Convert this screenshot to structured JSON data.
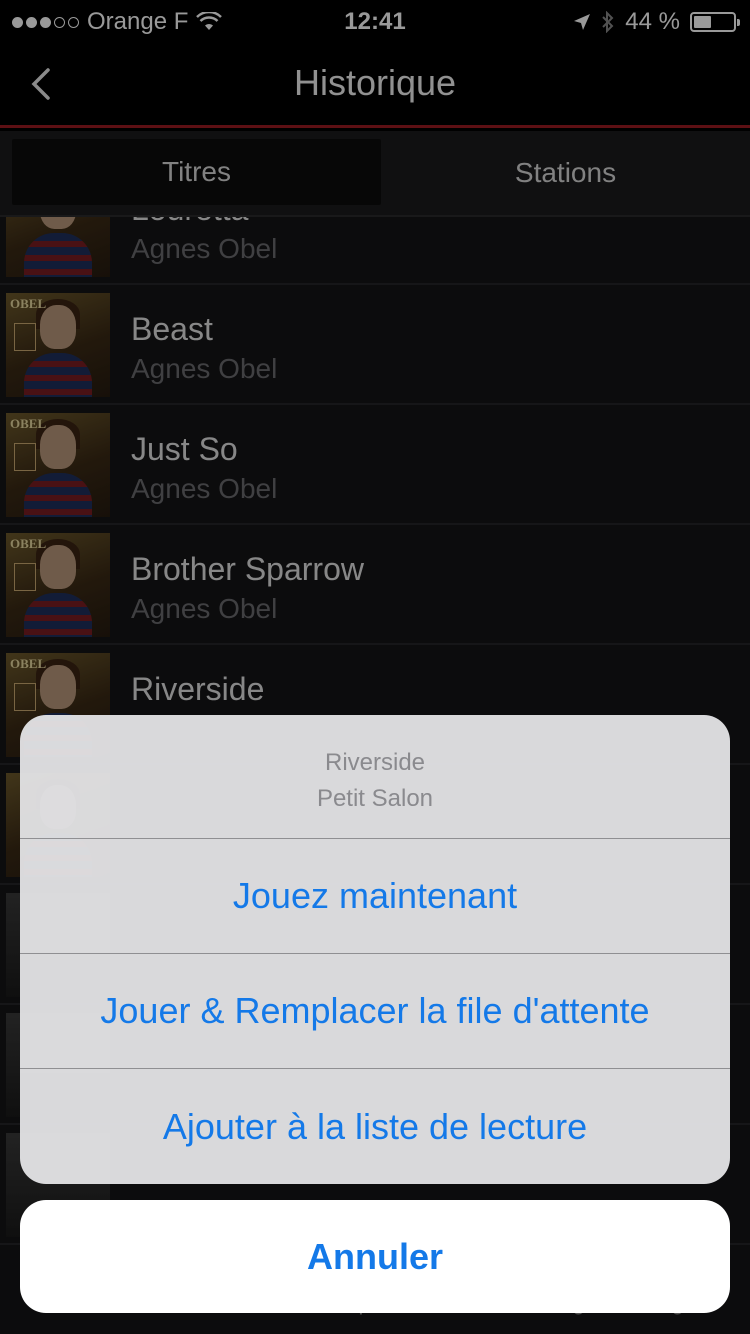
{
  "status_bar": {
    "carrier": "Orange F",
    "time": "12:41",
    "battery_percent": "44 %",
    "battery_level": 0.44
  },
  "nav": {
    "title": "Historique"
  },
  "tabs": [
    {
      "label": "Titres",
      "active": true
    },
    {
      "label": "Stations",
      "active": false
    }
  ],
  "list": {
    "rows": [
      {
        "title": "Louretta",
        "artist": "Agnes Obel"
      },
      {
        "title": "Beast",
        "artist": "Agnes Obel"
      },
      {
        "title": "Just So",
        "artist": "Agnes Obel"
      },
      {
        "title": "Brother Sparrow",
        "artist": "Agnes Obel"
      },
      {
        "title": "Riverside",
        "artist": ""
      },
      {
        "title": "",
        "artist": ""
      },
      {
        "title": "",
        "artist": ""
      },
      {
        "title": "",
        "artist": ""
      },
      {
        "title": "",
        "artist": ""
      }
    ]
  },
  "album_logo": "OBEL",
  "bottom_tabs": [
    "Petit Salon",
    "Musique",
    "Falling, Catching"
  ],
  "action_sheet": {
    "title": "Riverside",
    "subtitle": "Petit Salon",
    "actions": [
      "Jouez maintenant",
      "Jouer & Remplacer la file d'attente",
      "Ajouter à la liste de lecture"
    ],
    "cancel": "Annuler"
  }
}
